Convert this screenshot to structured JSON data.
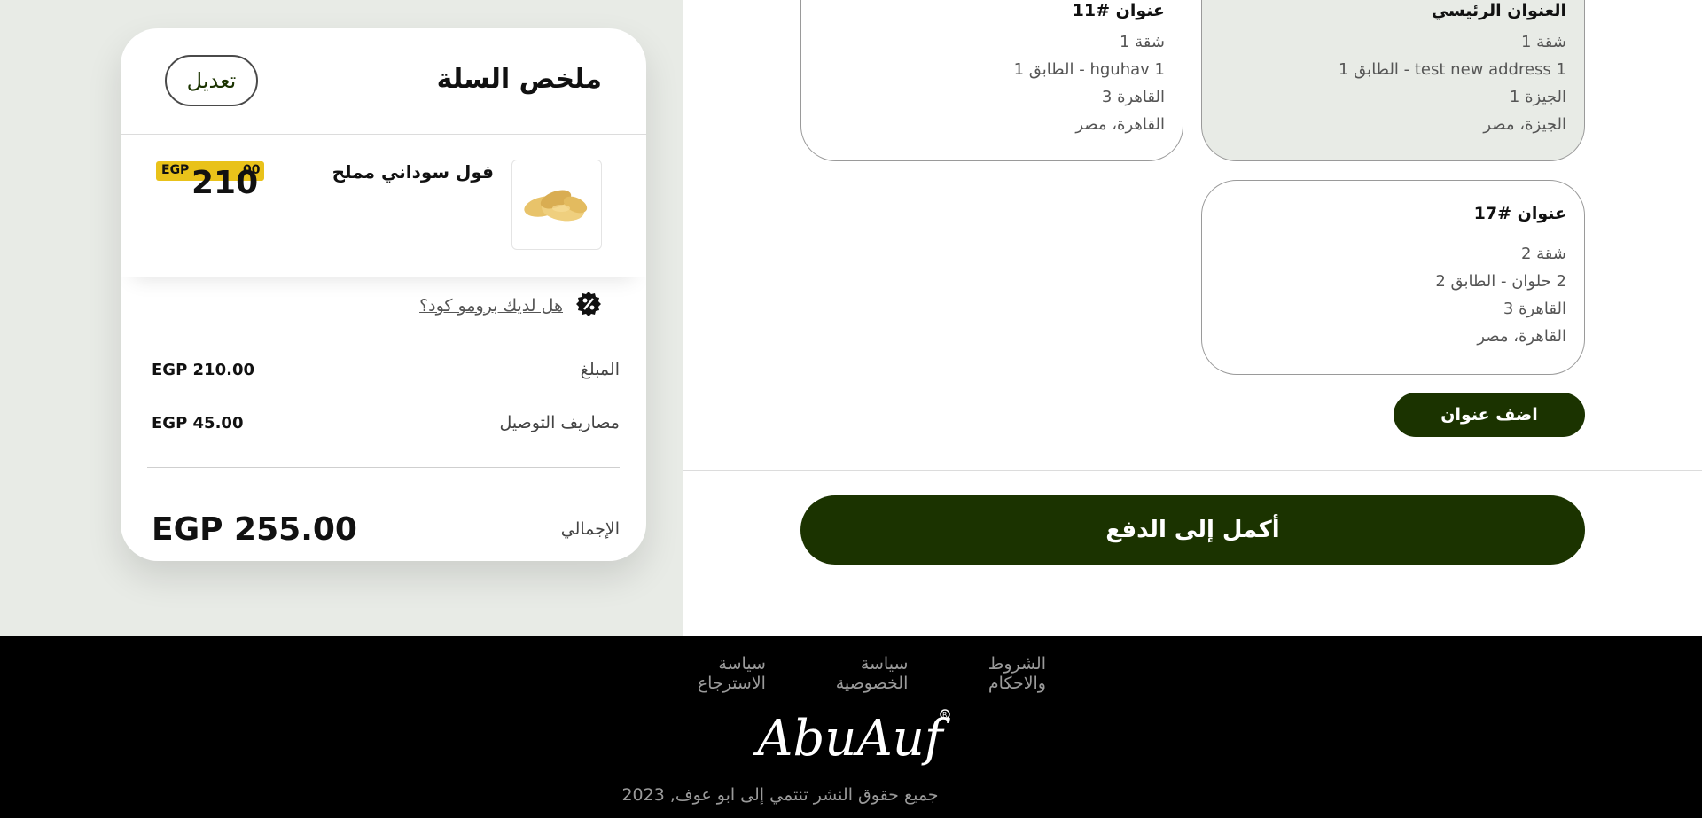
{
  "cart_summary": {
    "title": "ملخص السلة",
    "edit_label": "تعديل",
    "product": {
      "name": "فول سوداني مملح",
      "currency": "EGP",
      "price_int": "210",
      "price_dec": "00"
    },
    "promo_label": "هل لديك برومو كود؟",
    "amount_label": "المبلغ",
    "amount_value": "EGP 210.00",
    "delivery_label": "مصاريف التوصيل",
    "delivery_value": "EGP 45.00",
    "total_label": "الإجمالي",
    "total_value": "EGP 255.00"
  },
  "addresses": {
    "card_11": {
      "title": "عنوان #11",
      "lines": [
        "شقة 1",
        "1 hguhav - الطابق 1",
        "القاهرة 3",
        "القاهرة، مصر"
      ]
    },
    "card_main": {
      "title": "العنوان الرئيسي",
      "lines": [
        "شقة 1",
        "1 test new address - الطابق 1",
        "الجيزة 1",
        "الجيزة، مصر"
      ]
    },
    "card_17": {
      "title": "عنوان #17",
      "lines": [
        "شقة 2",
        "2 حلوان - الطابق 2",
        "القاهرة 3",
        "القاهرة، مصر"
      ]
    },
    "add_label": "اضف عنوان"
  },
  "checkout_label": "أكمل إلى الدفع",
  "footer": {
    "links": [
      "الشروط والاحكام",
      "سياسة الخصوصية",
      "سياسة الاسترجاع"
    ],
    "logo_text": "AbuAuf",
    "copyright": "جميع حقوق النشر تنتمي إلى ابو عوف, 2023"
  },
  "colors": {
    "brand_dark_green": "#1b3300",
    "price_yellow": "#e9c21a",
    "panel_grey": "#e8ebe6"
  },
  "icons": [
    "percent-badge-icon",
    "product-image"
  ]
}
